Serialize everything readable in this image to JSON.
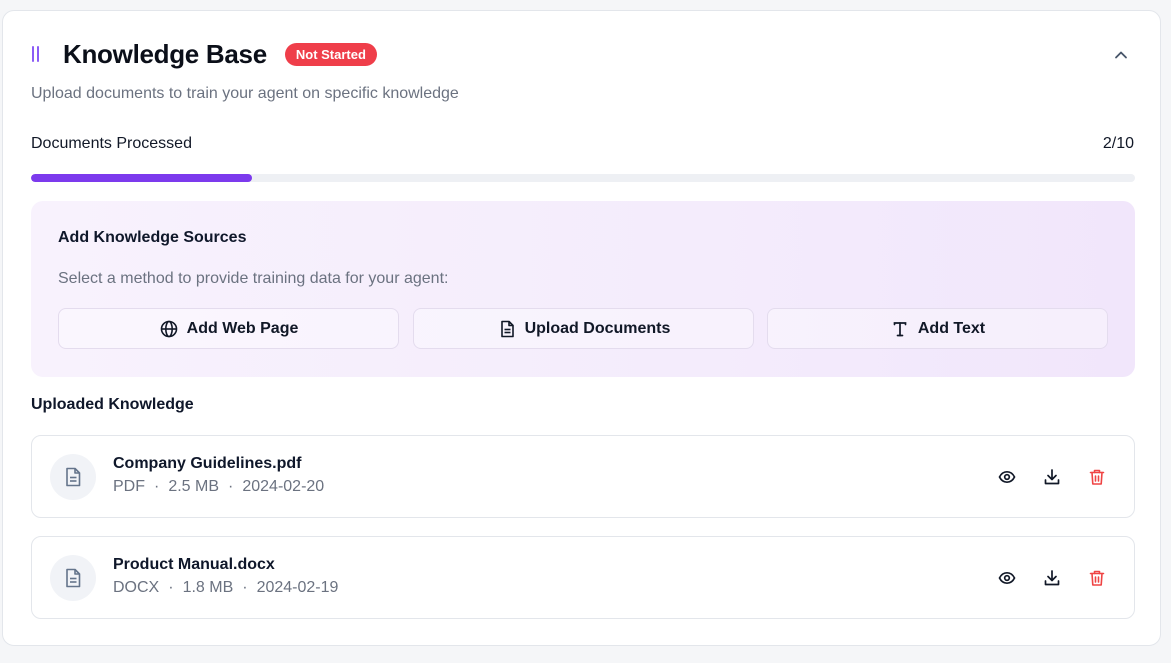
{
  "header": {
    "title": "Knowledge Base",
    "status_badge": "Not Started",
    "subtitle": "Upload documents to train your agent on specific knowledge"
  },
  "progress": {
    "label": "Documents Processed",
    "count_text": "2/10",
    "fraction": 0.2
  },
  "sources": {
    "title": "Add Knowledge Sources",
    "description": "Select a method to provide training data for your agent:",
    "methods": [
      {
        "label": "Add Web Page",
        "icon": "globe-icon"
      },
      {
        "label": "Upload Documents",
        "icon": "document-icon"
      },
      {
        "label": "Add Text",
        "icon": "text-icon"
      }
    ]
  },
  "uploaded": {
    "title": "Uploaded Knowledge",
    "files": [
      {
        "name": "Company Guidelines.pdf",
        "type": "PDF",
        "size": "2.5 MB",
        "date": "2024-02-20"
      },
      {
        "name": "Product Manual.docx",
        "type": "DOCX",
        "size": "1.8 MB",
        "date": "2024-02-19"
      }
    ],
    "separator": "·"
  },
  "colors": {
    "accent": "#7c3aed",
    "badge": "#ef3e4a",
    "delete": "#ef4444"
  }
}
